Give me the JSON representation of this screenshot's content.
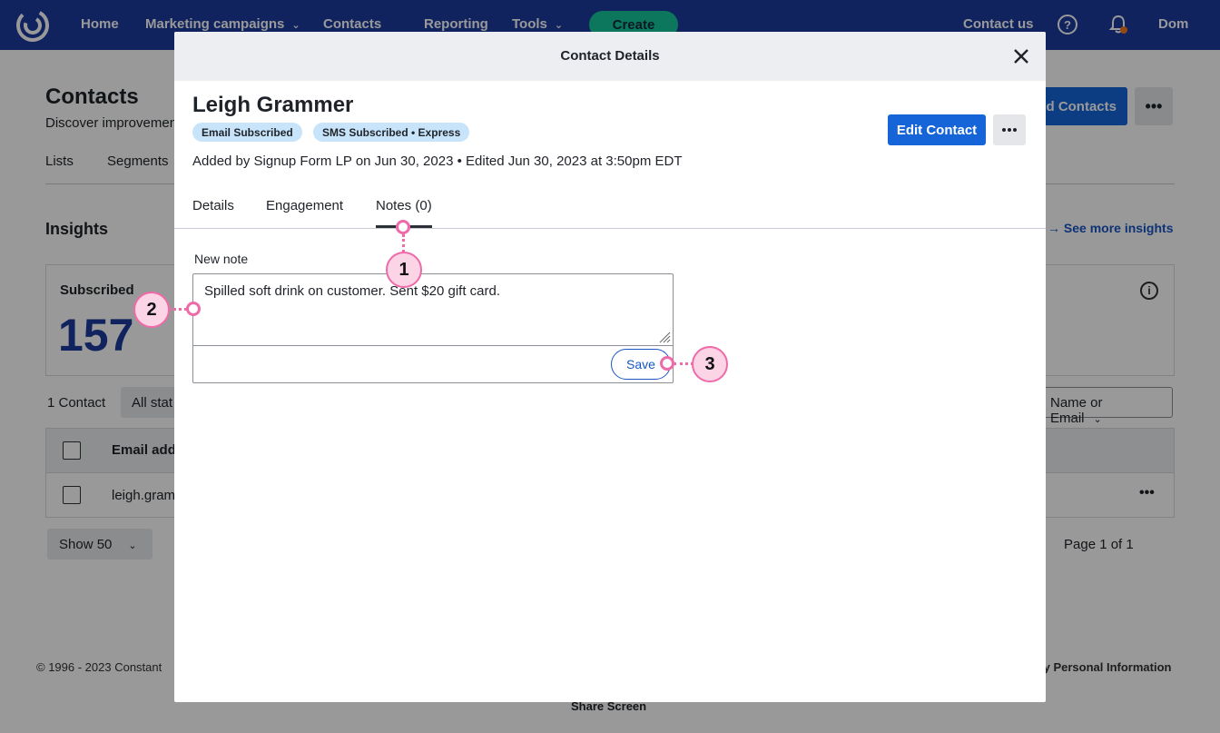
{
  "nav": {
    "items": [
      "Home",
      "Marketing campaigns",
      "Contacts",
      "Reporting",
      "Tools"
    ],
    "create_label": "Create",
    "contact_us": "Contact us",
    "help_glyph": "?",
    "user": "Dom"
  },
  "background": {
    "page_title": "Contacts",
    "subtitle": "Discover improvements",
    "tabs": [
      "Lists",
      "Segments"
    ],
    "insights_title": "Insights",
    "see_more": "See more insights",
    "subscribed_label": "Subscribed",
    "subscribed_count": "157",
    "add_contacts": "d Contacts",
    "more_glyph": "•••",
    "info_glyph": "i",
    "contact_count": "1 Contact",
    "status_filter": "All stat",
    "search_by": "Name or Email",
    "col_email": "Email addr",
    "row_email": "leigh.gram",
    "show_label": "Show 50",
    "page_indicator": "Page 1 of 1",
    "footer_left": "© 1996 - 2023 Constant",
    "footer_right": "ly Personal Information",
    "share_screen": "Share Screen"
  },
  "modal": {
    "title": "Contact Details",
    "contact_name": "Leigh Grammer",
    "badges": [
      "Email Subscribed",
      "SMS Subscribed • Express"
    ],
    "meta": "Added by Signup Form LP on Jun 30, 2023 • Edited Jun 30, 2023 at 3:50pm EDT",
    "edit_button": "Edit Contact",
    "tabs": [
      "Details",
      "Engagement",
      "Notes (0)"
    ],
    "active_tab": "Notes (0)",
    "note_label": "New note",
    "note_value": "Spilled soft drink on customer. Sent $20 gift card.",
    "save_button": "Save"
  },
  "callouts": [
    "1",
    "2",
    "3"
  ],
  "colors": {
    "nav_bg": "#1b3b9e",
    "primary": "#1565d8",
    "badge_bg": "#c7e4fa",
    "create_bg": "#14c79b",
    "callout": "#ef6aa8"
  }
}
